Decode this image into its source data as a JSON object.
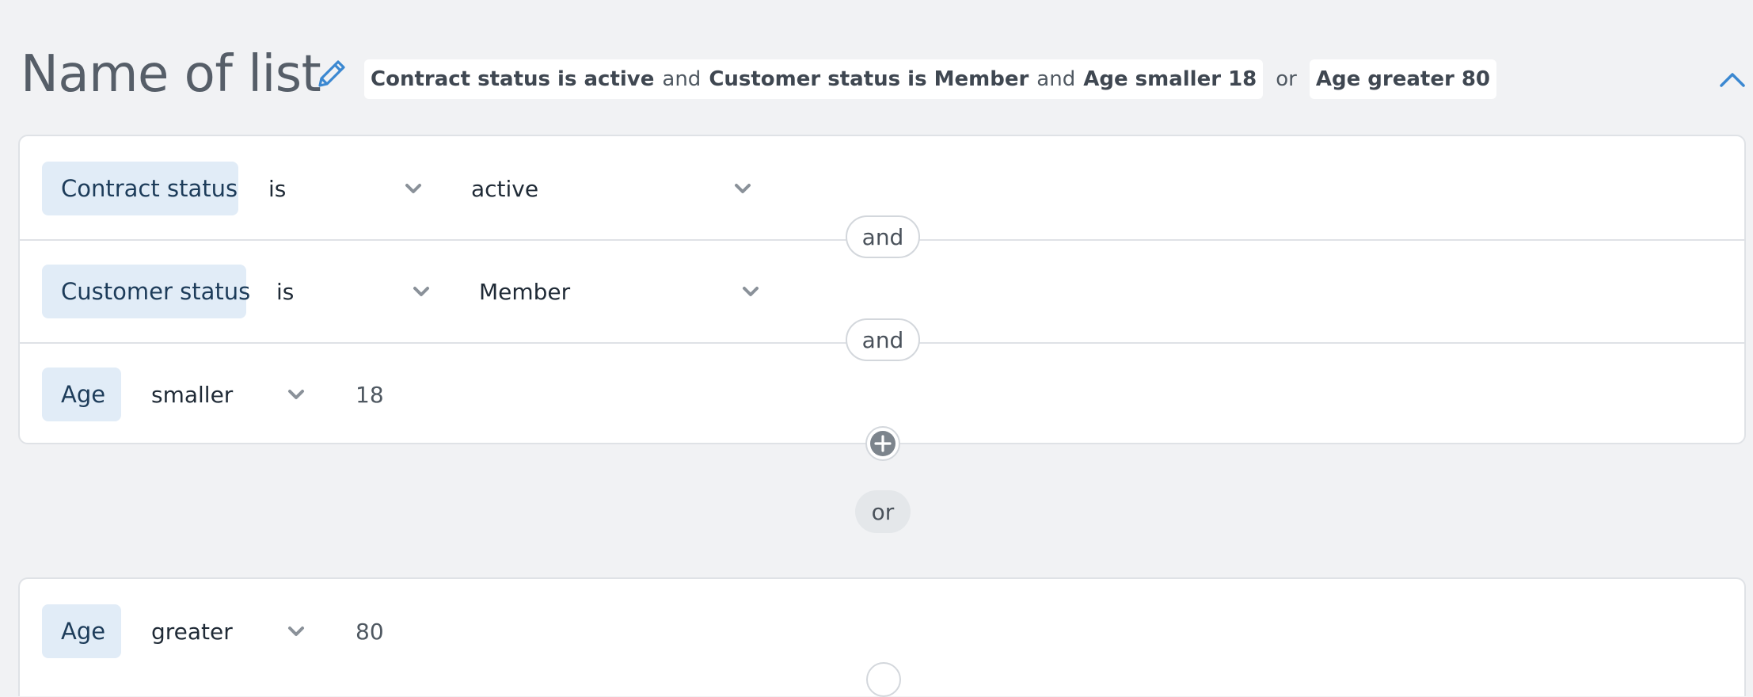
{
  "header": {
    "title": "Name of list",
    "summary": {
      "chip1": {
        "cond1": "Contract status is active",
        "conj1": "and",
        "cond2": "Customer status is Member",
        "conj2": "and",
        "cond3": "Age smaller 18"
      },
      "or_label": "or",
      "chip2": {
        "cond1": "Age greater 80"
      }
    }
  },
  "groups": [
    {
      "conditions": [
        {
          "field": "Contract status",
          "operator": "is",
          "value": "active"
        },
        {
          "field": "Customer status",
          "operator": "is",
          "value": "Member"
        },
        {
          "field": "Age",
          "operator": "smaller",
          "value": "18"
        }
      ],
      "connectors": [
        "and",
        "and"
      ]
    },
    {
      "conditions": [
        {
          "field": "Age",
          "operator": "greater",
          "value": "80"
        }
      ]
    }
  ],
  "group_connector": "or",
  "icons": {
    "edit": "pencil-icon",
    "collapse": "chevron-up-icon",
    "dropdown": "chevron-down-icon",
    "add": "plus-circle-icon"
  },
  "colors": {
    "accent": "#3b88d1",
    "chip_bg": "#e1ecf7",
    "background": "#f1f2f4"
  }
}
